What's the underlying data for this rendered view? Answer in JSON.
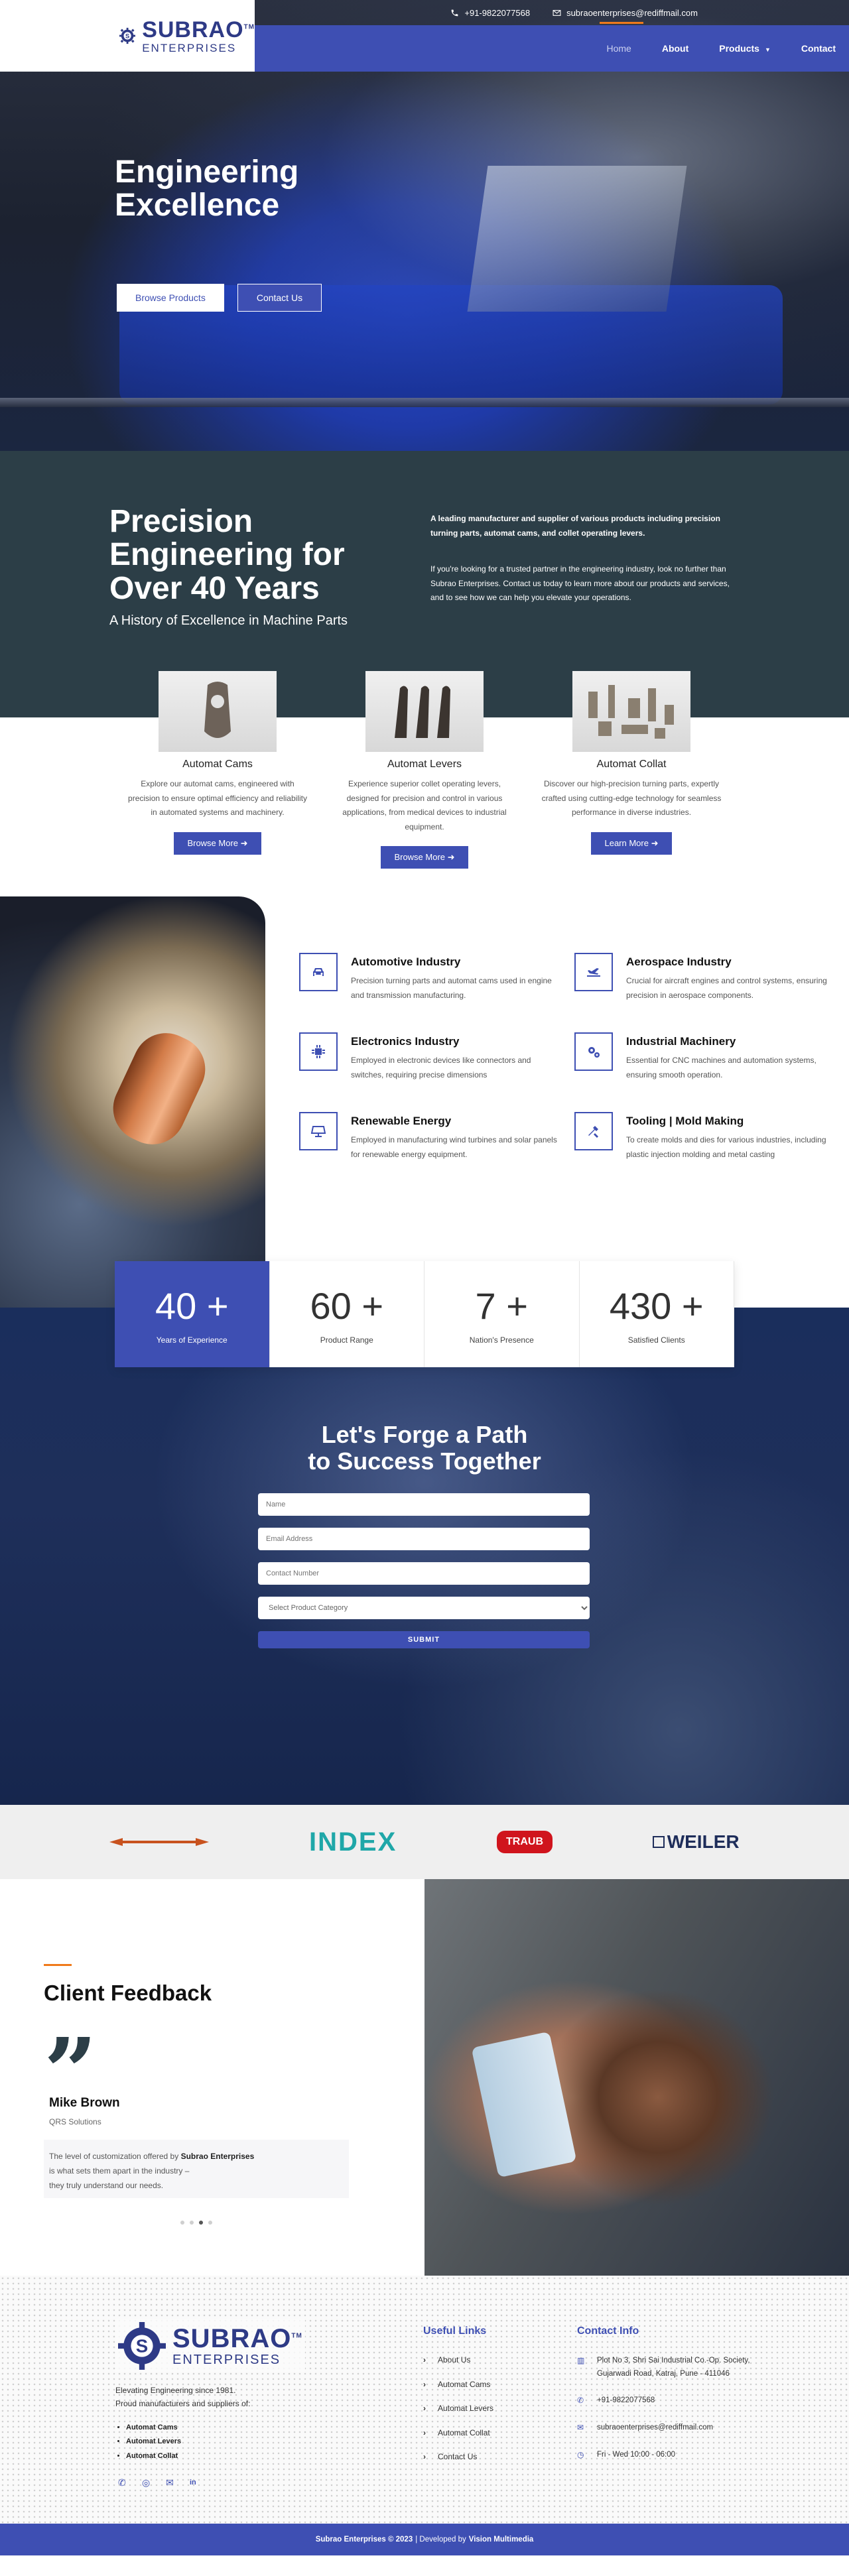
{
  "topbar": {
    "phone": "+91-9822077568",
    "email": "subraoenterprises@rediffmail.com"
  },
  "brand": {
    "name": "SUBRAO",
    "tm": "TM",
    "sub": "ENTERPRISES",
    "colors": {
      "primary": "#3e4fb3",
      "accent": "#f07a1a",
      "dark": "#2c3e47"
    }
  },
  "nav": {
    "items": [
      {
        "label": "Home"
      },
      {
        "label": "About"
      },
      {
        "label": "Products"
      },
      {
        "label": "Contact"
      }
    ]
  },
  "hero": {
    "title_line1": "Engineering",
    "title_line2": "Excellence",
    "btn_browse": "Browse Products",
    "btn_contact": "Contact Us"
  },
  "precision": {
    "title_l1": "Precision",
    "title_l2": "Engineering for",
    "title_l3": "Over 40 Years",
    "subtitle": "A History of Excellence in Machine Parts",
    "p1": "A leading manufacturer and supplier of various products including precision turning parts, automat cams, and collet operating levers.",
    "p2": "If you're looking for a trusted partner in the engineering industry, look no further than Subrao Enterprises. Contact us today to learn more about our products and services, and to see how we can help you elevate your operations."
  },
  "products": [
    {
      "title": "Automat Cams",
      "desc": "Explore our automat cams, engineered with precision to ensure optimal efficiency and reliability in automated systems and machinery.",
      "button": "Browse More"
    },
    {
      "title": "Automat Levers",
      "desc": "Experience superior collet operating levers, designed for precision and control in various applications, from medical devices to industrial equipment.",
      "button": "Browse More"
    },
    {
      "title": "Automat Collat",
      "desc": "Discover our high-precision turning parts, expertly crafted using cutting-edge technology for seamless performance in diverse industries.",
      "button": "Learn More"
    }
  ],
  "industries": [
    {
      "icon": "car-icon",
      "title": "Automotive Industry",
      "desc": "Precision turning parts and automat cams used in engine and transmission manufacturing."
    },
    {
      "icon": "plane-icon",
      "title": "Aerospace Industry",
      "desc": "Crucial for aircraft engines and control systems, ensuring precision in aerospace components."
    },
    {
      "icon": "chip-icon",
      "title": "Electronics Industry",
      "desc": "Employed in electronic devices like connectors and switches, requiring precise dimensions"
    },
    {
      "icon": "gears-icon",
      "title": "Industrial Machinery",
      "desc": "Essential for CNC machines and automation systems, ensuring smooth operation."
    },
    {
      "icon": "solar-panel-icon",
      "title": "Renewable Energy",
      "desc": "Employed in manufacturing wind turbines and solar panels for renewable energy equipment."
    },
    {
      "icon": "tools-icon",
      "title": "Tooling | Mold Making",
      "desc": "To create molds and dies for various industries, including plastic injection molding and metal casting"
    }
  ],
  "stats": [
    {
      "num": "40 +",
      "label": "Years of Experience"
    },
    {
      "num": "60 +",
      "label": "Product Range"
    },
    {
      "num": "7 +",
      "label": "Nation's Presence"
    },
    {
      "num": "430 +",
      "label": "Satisfied Clients"
    }
  ],
  "form": {
    "title_l1": "Let's Forge a Path",
    "title_l2": "to Success Together",
    "name_ph": "Name",
    "email_ph": "Email Address",
    "phone_ph": "Contact Number",
    "select_value": "Select Product Category",
    "submit": "SUBMIT"
  },
  "brands": [
    {
      "name": "INDEX"
    },
    {
      "name": "TRAUB"
    },
    {
      "name": "WEILER"
    }
  ],
  "feedback": {
    "title": "Client Feedback",
    "name": "Mike Brown",
    "company": "QRS Solutions",
    "text_pre": "The level of customization offered by ",
    "text_bold": "Subrao Enterprises",
    "text_l2": "is what sets them apart in the industry –",
    "text_l3": "they truly understand our needs."
  },
  "footer": {
    "desc_l1": "Elevating Engineering since 1981.",
    "desc_l2": "Proud manufacturers and suppliers of:",
    "list": [
      "Automat Cams",
      "Automat Levers",
      "Automat Collat"
    ],
    "links_title": "Useful Links",
    "links": [
      "About Us",
      "Automat Cams",
      "Automat Levers",
      "Automat Collat",
      "Contact Us"
    ],
    "contact_title": "Contact Info",
    "address": "Plot No 3, Shri Sai Industrial Co.-Op. Society, Gujarwadi Road, Katraj, Pune - 411046",
    "phone": "+91-9822077568",
    "email": "subraoenterprises@rediffmail.com",
    "hours": "Fri - Wed 10:00 - 06:00"
  },
  "bottombar": {
    "copyright": "Subrao Enterprises © 2023",
    "sep": "| Developed by",
    "dev": "Vision Multimedia"
  }
}
